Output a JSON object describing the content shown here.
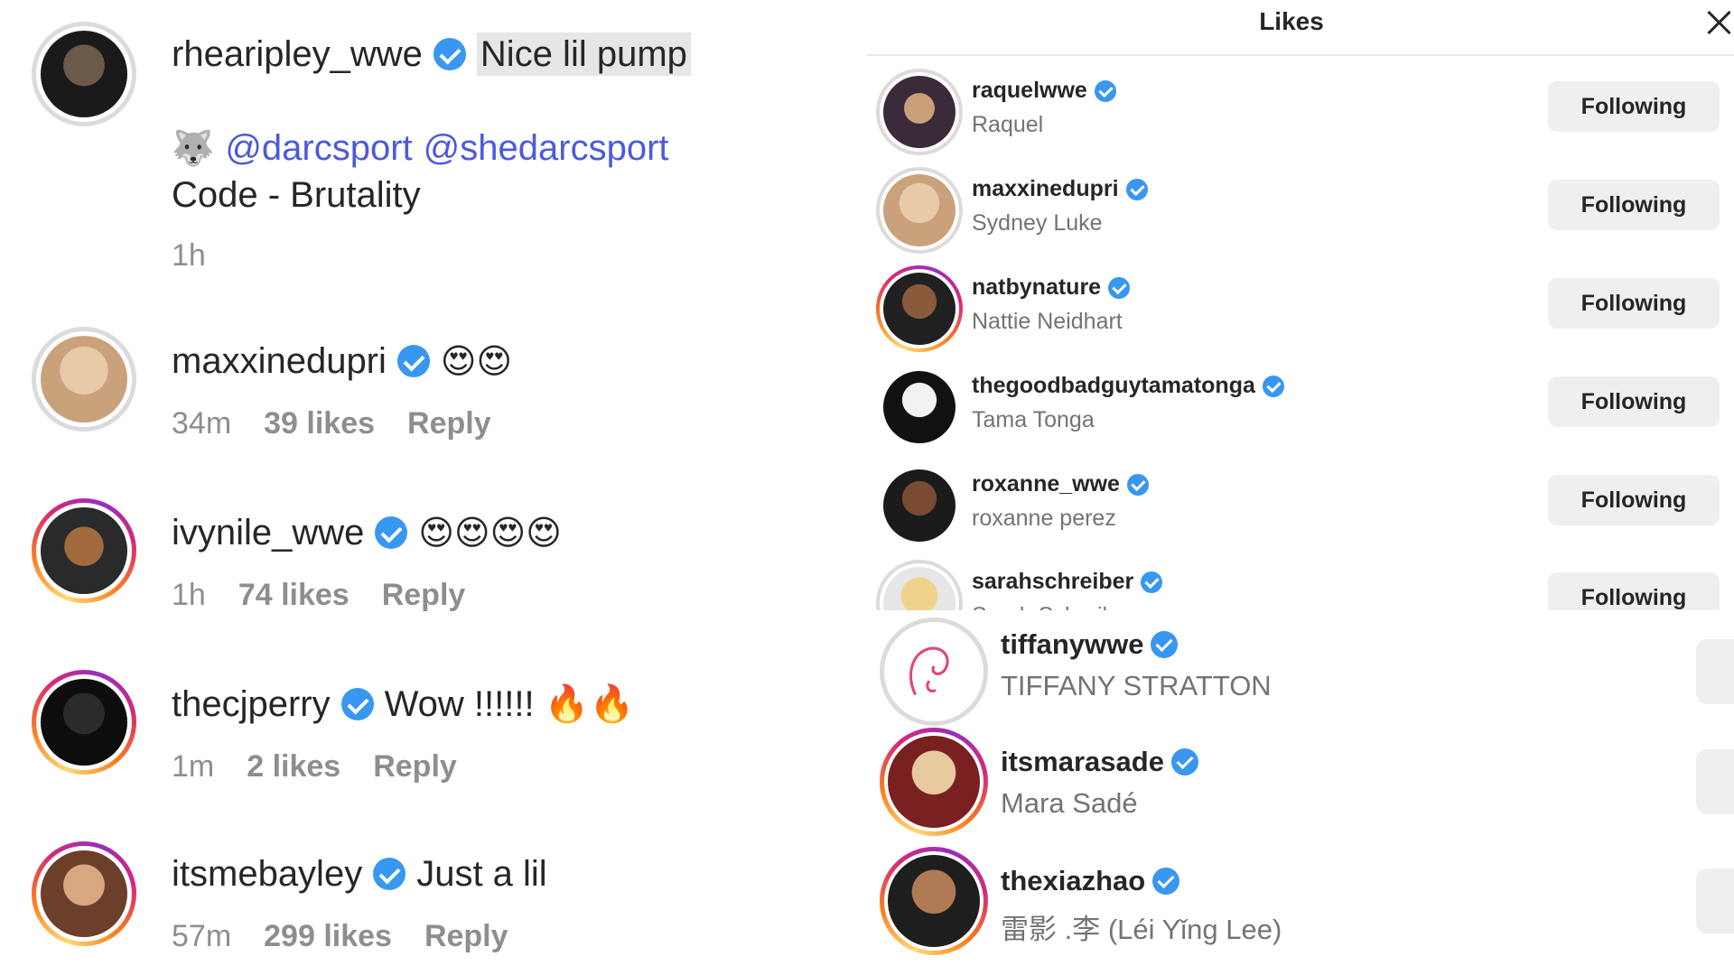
{
  "comments": [
    {
      "username": "rhearipley_wwe",
      "text": "Nice lil pump",
      "line2_emoji": "🐺",
      "mention1": "@darcsport",
      "mention2": "@shedarcsport",
      "line3": "Code - Brutality",
      "time": "1h"
    },
    {
      "username": "maxxinedupri",
      "text": "😍😍",
      "time": "34m",
      "likes": "39 likes",
      "reply": "Reply"
    },
    {
      "username": "ivynile_wwe",
      "text": "😍😍😍😍",
      "time": "1h",
      "likes": "74 likes",
      "reply": "Reply"
    },
    {
      "username": "thecjperry",
      "text": "Wow !!!!!! 🔥🔥",
      "time": "1m",
      "likes": "2 likes",
      "reply": "Reply"
    },
    {
      "username": "itsmebayley",
      "text": "Just a lil",
      "time": "57m",
      "likes": "299 likes",
      "reply": "Reply"
    }
  ],
  "likes_panel": {
    "title": "Likes",
    "users": [
      {
        "username": "raquelwwe",
        "name": "Raquel",
        "button": "Following"
      },
      {
        "username": "maxxinedupri",
        "name": "Sydney Luke",
        "button": "Following"
      },
      {
        "username": "natbynature",
        "name": "Nattie Neidhart",
        "button": "Following"
      },
      {
        "username": "thegoodbadguytamatonga",
        "name": "Tama Tonga",
        "button": "Following"
      },
      {
        "username": "roxanne_wwe",
        "name": "roxanne perez",
        "button": "Following"
      },
      {
        "username": "sarahschreiber",
        "name": "Sarah Schreiber",
        "button": "Following"
      },
      {
        "username": "tiffanywwe",
        "name": "TIFFANY STRATTON"
      },
      {
        "username": "itsmarasade",
        "name": "Mara Sadé"
      },
      {
        "username": "thexiazhao",
        "name": "雷影 .李 (Léi Yǐng Lee)"
      }
    ]
  },
  "colors": {
    "verified": "#3897f0",
    "mention": "#4d5ad8",
    "meta_gray": "#8e8e8e",
    "button_bg": "#efefef"
  }
}
